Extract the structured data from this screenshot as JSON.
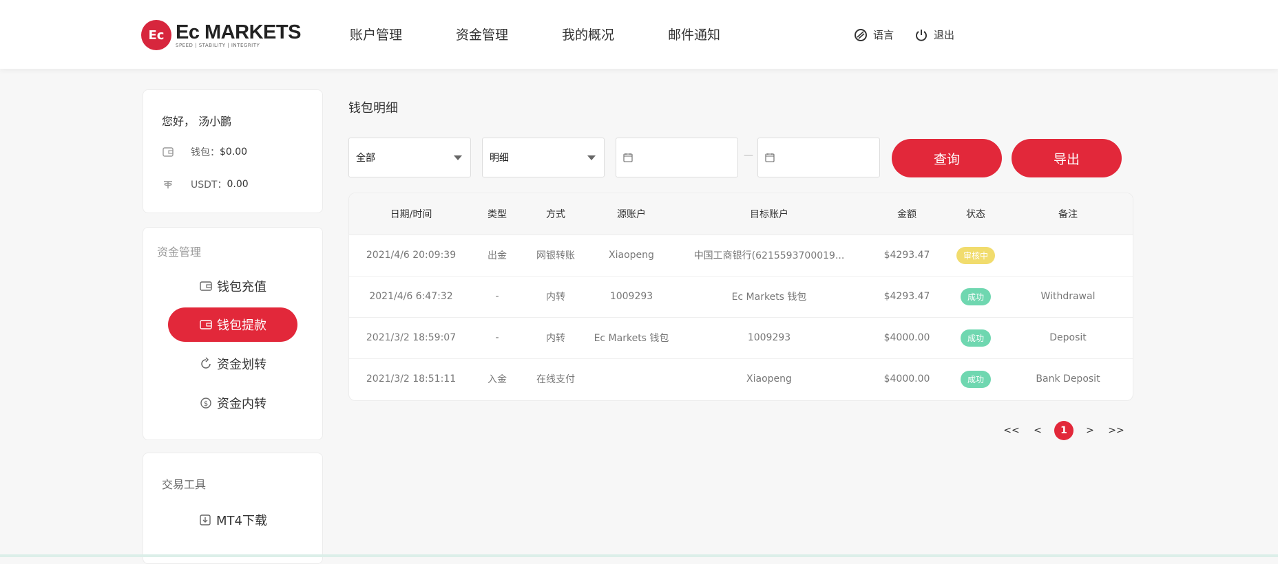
{
  "header": {
    "logo_name": "Ec MARKETS",
    "logo_tagline": "SPEED | STABILITY | INTEGRITY",
    "nav": [
      "账户管理",
      "资金管理",
      "我的概况",
      "邮件通知"
    ],
    "language_label": "语言",
    "logout_label": "退出"
  },
  "user": {
    "greeting": "您好， 汤小鹏",
    "wallet_label": "钱包：",
    "wallet_value": "$0.00",
    "usdt_label": "USDT：",
    "usdt_value": "0.00"
  },
  "funds_menu": {
    "title": "资金管理",
    "items": [
      "钱包充值",
      "钱包提款",
      "资金划转",
      "资金内转"
    ]
  },
  "tools_menu": {
    "title": "交易工具",
    "items": [
      "MT4下载"
    ]
  },
  "main": {
    "title": "钱包明细",
    "filter_type": "全部",
    "filter_detail": "明细",
    "date_separator": "—",
    "query_label": "查询",
    "export_label": "导出"
  },
  "table": {
    "headers": [
      "日期/时间",
      "类型",
      "方式",
      "源账户",
      "目标账户",
      "金额",
      "状态",
      "备注"
    ],
    "rows": [
      [
        "2021/4/6 20:09:39",
        "出金",
        "网银转账",
        "Xiaopeng",
        "中国工商银行(6215593700019...",
        "$4293.47",
        "审核中",
        ""
      ],
      [
        "2021/4/6 6:47:32",
        "-",
        "内转",
        "1009293",
        "Ec Markets 钱包",
        "$4293.47",
        "成功",
        "Withdrawal"
      ],
      [
        "2021/3/2 18:59:07",
        "-",
        "内转",
        "Ec Markets 钱包",
        "1009293",
        "$4000.00",
        "成功",
        "Deposit"
      ],
      [
        "2021/3/2 18:51:11",
        "入金",
        "在线支付",
        "",
        "Xiaopeng",
        "$4000.00",
        "成功",
        "Bank Deposit"
      ]
    ]
  },
  "pager": {
    "first": "<<",
    "prev": "<",
    "current": "1",
    "next": ">",
    "last": ">>"
  },
  "colors": {
    "accent": "#e2283a",
    "pending": "#f1dc6d",
    "success": "#6fd7b0"
  }
}
